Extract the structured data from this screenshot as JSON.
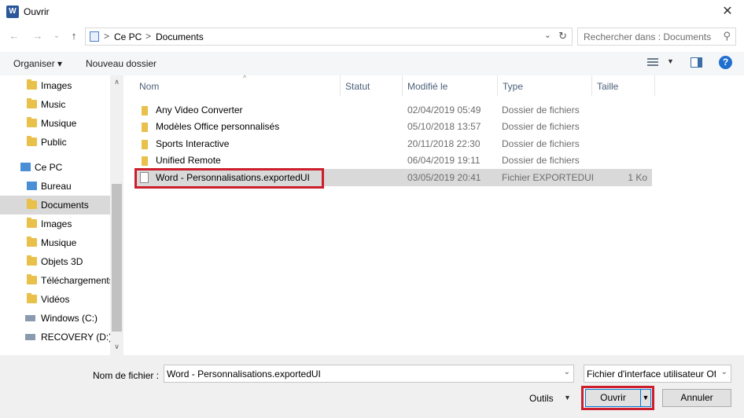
{
  "window": {
    "title": "Ouvrir",
    "app_icon_letter": "W"
  },
  "navigation": {
    "back_icon": "←",
    "forward_icon": "→",
    "recent_icon": "⌄",
    "up_icon": "↑",
    "address": {
      "segments": [
        "Ce PC",
        "Documents"
      ],
      "separator": ">"
    },
    "search_placeholder": "Rechercher dans : Documents"
  },
  "toolbar": {
    "organize_label": "Organiser ▾",
    "new_folder_label": "Nouveau dossier",
    "help_label": "?"
  },
  "sidebar": {
    "items": [
      {
        "label": "Images",
        "icon": "folder-icon",
        "selected": false
      },
      {
        "label": "Music",
        "icon": "folder-icon",
        "selected": false
      },
      {
        "label": "Musique",
        "icon": "folder-icon",
        "selected": false
      },
      {
        "label": "Public",
        "icon": "folder-icon",
        "selected": false
      },
      {
        "label": "Ce PC",
        "icon": "computer-icon",
        "selected": false
      },
      {
        "label": "Bureau",
        "icon": "folder-icon",
        "selected": false
      },
      {
        "label": "Documents",
        "icon": "documents-folder-icon",
        "selected": true
      },
      {
        "label": "Images",
        "icon": "pictures-folder-icon",
        "selected": false
      },
      {
        "label": "Musique",
        "icon": "music-folder-icon",
        "selected": false
      },
      {
        "label": "Objets 3D",
        "icon": "folder-icon",
        "selected": false
      },
      {
        "label": "Téléchargements",
        "icon": "downloads-folder-icon",
        "selected": false
      },
      {
        "label": "Vidéos",
        "icon": "videos-folder-icon",
        "selected": false
      },
      {
        "label": "Windows (C:)",
        "icon": "drive-icon",
        "selected": false
      },
      {
        "label": "RECOVERY (D:)",
        "icon": "drive-icon",
        "selected": false
      }
    ]
  },
  "filelist": {
    "columns": [
      "Nom",
      "Statut",
      "Modifié le",
      "Type",
      "Taille"
    ],
    "rows": [
      {
        "name": "Any Video Converter",
        "date": "02/04/2019 05:49",
        "type": "Dossier de fichiers",
        "size": "",
        "kind": "folder"
      },
      {
        "name": "Modèles Office personnalisés",
        "date": "05/10/2018 13:57",
        "type": "Dossier de fichiers",
        "size": "",
        "kind": "folder"
      },
      {
        "name": "Sports Interactive",
        "date": "20/11/2018 22:30",
        "type": "Dossier de fichiers",
        "size": "",
        "kind": "folder"
      },
      {
        "name": "Unified Remote",
        "date": "06/04/2019 19:11",
        "type": "Dossier de fichiers",
        "size": "",
        "kind": "folder"
      },
      {
        "name": "Word - Personnalisations.exportedUI",
        "date": "03/05/2019 20:41",
        "type": "Fichier EXPORTEDUI",
        "size": "1 Ko",
        "kind": "file"
      }
    ]
  },
  "footer": {
    "filename_label": "Nom de fichier :",
    "filename_value": "Word - Personnalisations.exportedUI",
    "filetype_value": "Fichier d'interface utilisateur Of",
    "tools_label": "Outils",
    "open_label": "Ouvrir",
    "cancel_label": "Annuler"
  },
  "colors": {
    "highlight_border": "#cc1e2b",
    "selection": "#d9d9d9",
    "folder": "#e8c04a",
    "accent": "#0078d7"
  }
}
